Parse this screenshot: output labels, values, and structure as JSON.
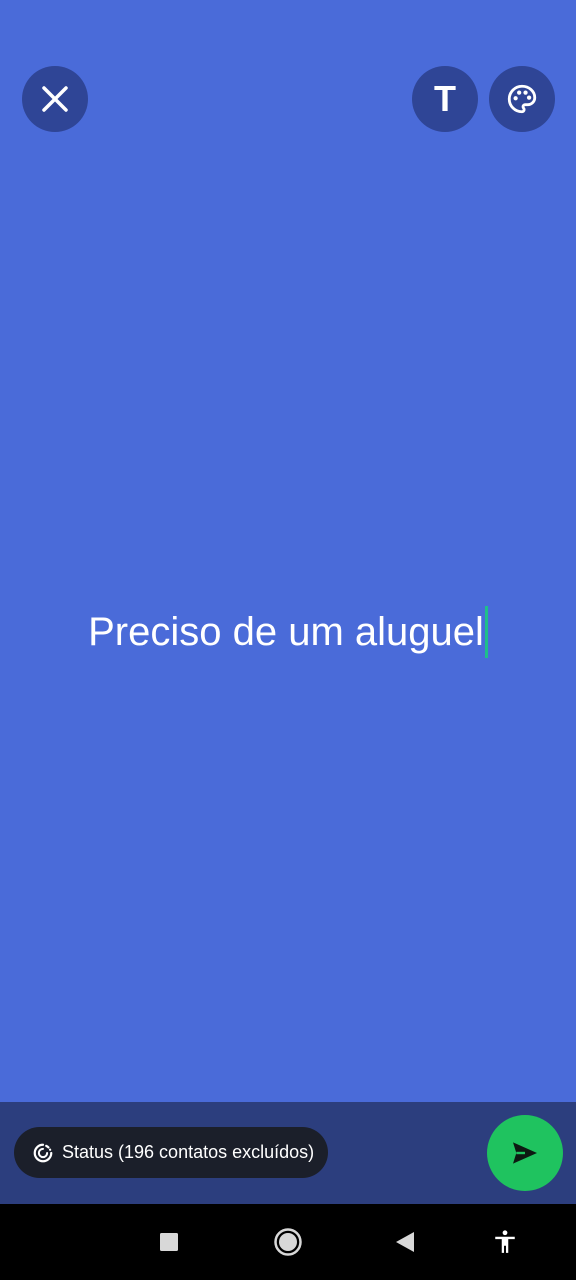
{
  "composer": {
    "text": "Preciso de um aluguel",
    "background_color": "#4a6bd9"
  },
  "toolbar": {
    "close_icon": "close-icon",
    "text_style_label": "T",
    "palette_icon": "palette-icon"
  },
  "privacy": {
    "label": "Status (196 contatos excluídos)",
    "icon": "status-privacy-icon"
  },
  "send": {
    "icon": "send-icon",
    "color": "#1fc35f"
  },
  "navigation": {
    "recents_icon": "square-icon",
    "home_icon": "circle-icon",
    "back_icon": "triangle-back-icon",
    "accessibility_icon": "accessibility-icon"
  }
}
